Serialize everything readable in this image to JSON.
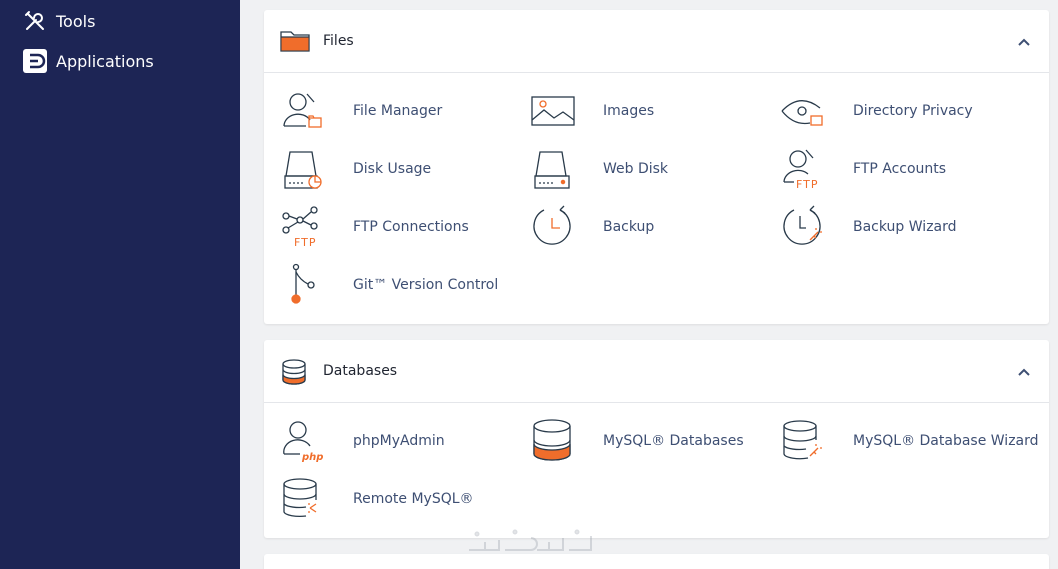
{
  "sidebar": {
    "items": [
      {
        "label": "Tools",
        "icon": "tools-icon"
      },
      {
        "label": "Applications",
        "icon": "applications-icon"
      }
    ]
  },
  "files": {
    "title": "Files",
    "items": [
      {
        "label": "File Manager",
        "icon": "file-manager-icon"
      },
      {
        "label": "Images",
        "icon": "images-icon"
      },
      {
        "label": "Directory Privacy",
        "icon": "directory-privacy-icon"
      },
      {
        "label": "Disk Usage",
        "icon": "disk-usage-icon"
      },
      {
        "label": "Web Disk",
        "icon": "web-disk-icon"
      },
      {
        "label": "FTP Accounts",
        "icon": "ftp-accounts-icon"
      },
      {
        "label": "FTP Connections",
        "icon": "ftp-connections-icon"
      },
      {
        "label": "Backup",
        "icon": "backup-icon"
      },
      {
        "label": "Backup Wizard",
        "icon": "backup-wizard-icon"
      },
      {
        "label": "Git™ Version Control",
        "icon": "git-icon"
      }
    ]
  },
  "databases": {
    "title": "Databases",
    "items": [
      {
        "label": "phpMyAdmin",
        "icon": "phpmyadmin-icon"
      },
      {
        "label": "MySQL® Databases",
        "icon": "mysql-databases-icon"
      },
      {
        "label": "MySQL® Database Wizard",
        "icon": "mysql-wizard-icon"
      },
      {
        "label": "Remote MySQL®",
        "icon": "remote-mysql-icon"
      }
    ]
  },
  "colors": {
    "sidebar_bg": "#1d2555",
    "accent": "#f06d2b",
    "link": "#3e4f73",
    "icon_stroke": "#293a4a"
  }
}
